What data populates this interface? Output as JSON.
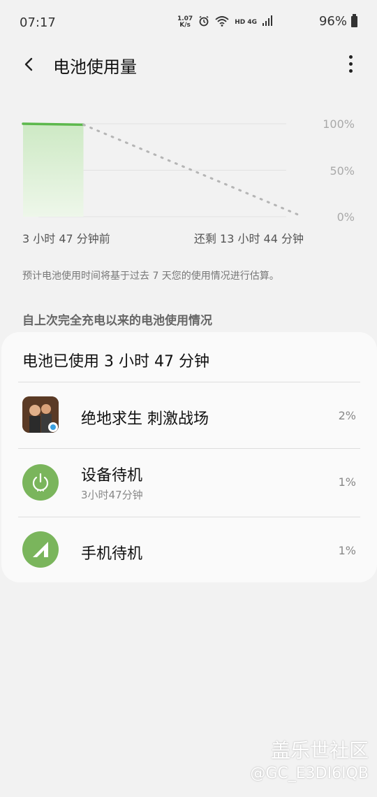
{
  "status_bar": {
    "time": "07:17",
    "net_speed_value": "1.07",
    "net_speed_unit": "K/s",
    "signal_label": "HD 4G",
    "battery_percent": "96%"
  },
  "header": {
    "title": "电池使用量",
    "back_icon": "chevron-left-icon",
    "more_icon": "more-vertical-icon"
  },
  "chart": {
    "y_labels": [
      "100%",
      "50%",
      "0%"
    ],
    "x_start_label": "3 小时 47 分钟前",
    "x_end_label": "还剩 13 小时 44 分钟",
    "line_color": "#5cb84c",
    "fill_color": "#d9efd2",
    "projection_color": "#b5b5b5"
  },
  "chart_data": {
    "type": "line",
    "title": "",
    "xlabel": "",
    "ylabel": "",
    "ylim": [
      0,
      100
    ],
    "series": [
      {
        "name": "",
        "x": [
          0,
          3.78
        ],
        "values": [
          100,
          99
        ]
      },
      {
        "name": "",
        "x": [
          3.78,
          17.52
        ],
        "values": [
          99,
          0
        ]
      }
    ]
  },
  "note": "预计电池使用时间将基于过去 7 天您的使用情况进行估算。",
  "section_title": "自上次完全充电以来的电池使用情况",
  "card": {
    "header": "电池已使用 3 小时 47 分钟",
    "items": [
      {
        "name": "绝地求生 刺激战场",
        "sub": "",
        "percent": "2%",
        "icon": "game-icon"
      },
      {
        "name": "设备待机",
        "sub": "3小时47分钟",
        "percent": "1%",
        "icon": "power-icon"
      },
      {
        "name": "手机待机",
        "sub": "",
        "percent": "1%",
        "icon": "signal-icon"
      }
    ]
  },
  "watermark": {
    "site": "盖乐世社区",
    "user": "@GC_E3DI6IQB"
  }
}
